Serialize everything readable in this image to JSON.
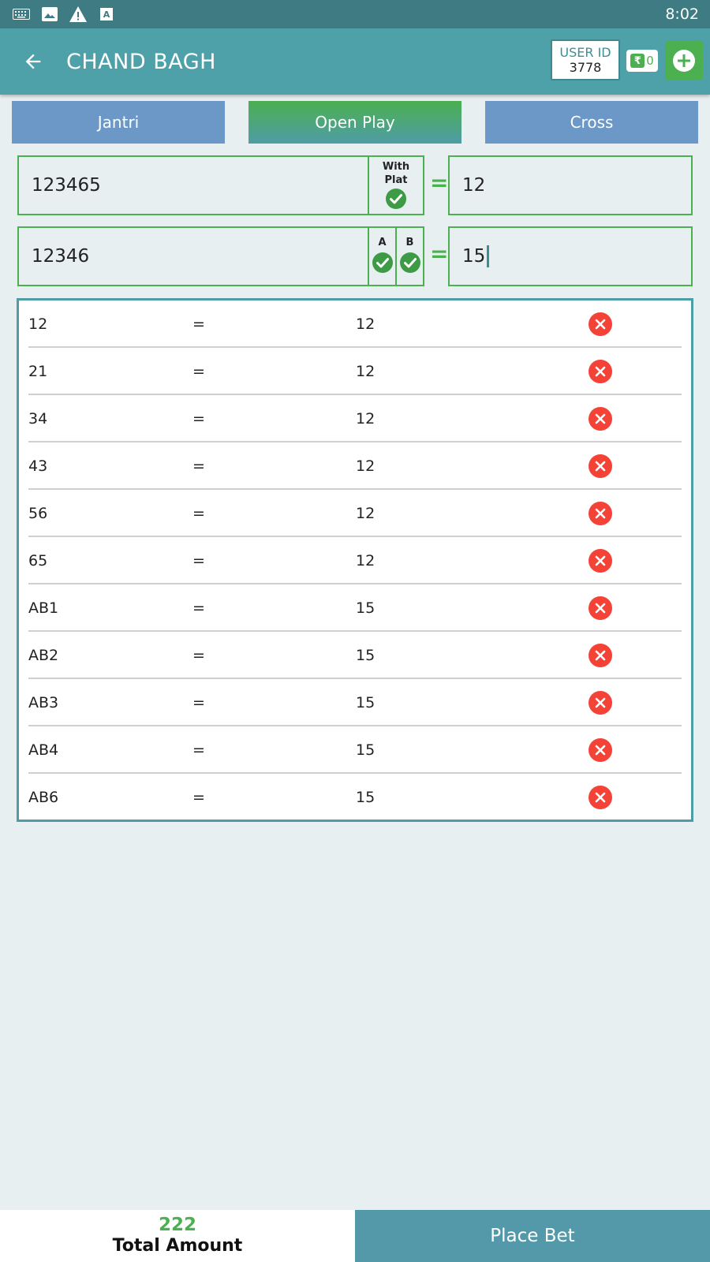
{
  "status_bar": {
    "time": "8:02",
    "icons": [
      "keyboard-icon",
      "image-icon",
      "warning-icon",
      "text-a-icon"
    ]
  },
  "app_bar": {
    "title": "CHAND BAGH",
    "user_id_label": "USER ID",
    "user_id_value": "3778",
    "wallet_symbol": "₹",
    "wallet_balance": "0"
  },
  "tabs": [
    {
      "label": "Jantri",
      "active": false
    },
    {
      "label": "Open Play",
      "active": true
    },
    {
      "label": "Cross",
      "active": false
    }
  ],
  "row1": {
    "number": "123465",
    "check_label_line1": "With",
    "check_label_line2": "Plat",
    "equals": "=",
    "amount": "12"
  },
  "row2": {
    "number": "12346",
    "check_a_label": "A",
    "check_b_label": "B",
    "equals": "=",
    "amount": "15"
  },
  "bets": [
    {
      "num": "12",
      "eq": "=",
      "amt": "12"
    },
    {
      "num": "21",
      "eq": "=",
      "amt": "12"
    },
    {
      "num": "34",
      "eq": "=",
      "amt": "12"
    },
    {
      "num": "43",
      "eq": "=",
      "amt": "12"
    },
    {
      "num": "56",
      "eq": "=",
      "amt": "12"
    },
    {
      "num": "65",
      "eq": "=",
      "amt": "12"
    },
    {
      "num": "AB1",
      "eq": "=",
      "amt": "15"
    },
    {
      "num": "AB2",
      "eq": "=",
      "amt": "15"
    },
    {
      "num": "AB3",
      "eq": "=",
      "amt": "15"
    },
    {
      "num": "AB4",
      "eq": "=",
      "amt": "15"
    },
    {
      "num": "AB6",
      "eq": "=",
      "amt": "15"
    }
  ],
  "footer": {
    "total_value": "222",
    "total_label": "Total Amount",
    "place_bet_label": "Place Bet"
  },
  "colors": {
    "status_bar": "#3f7b82",
    "app_bar": "#4ea1a9",
    "tab": "#6b98c7",
    "green": "#4caf50",
    "delete_red": "#f44336"
  }
}
